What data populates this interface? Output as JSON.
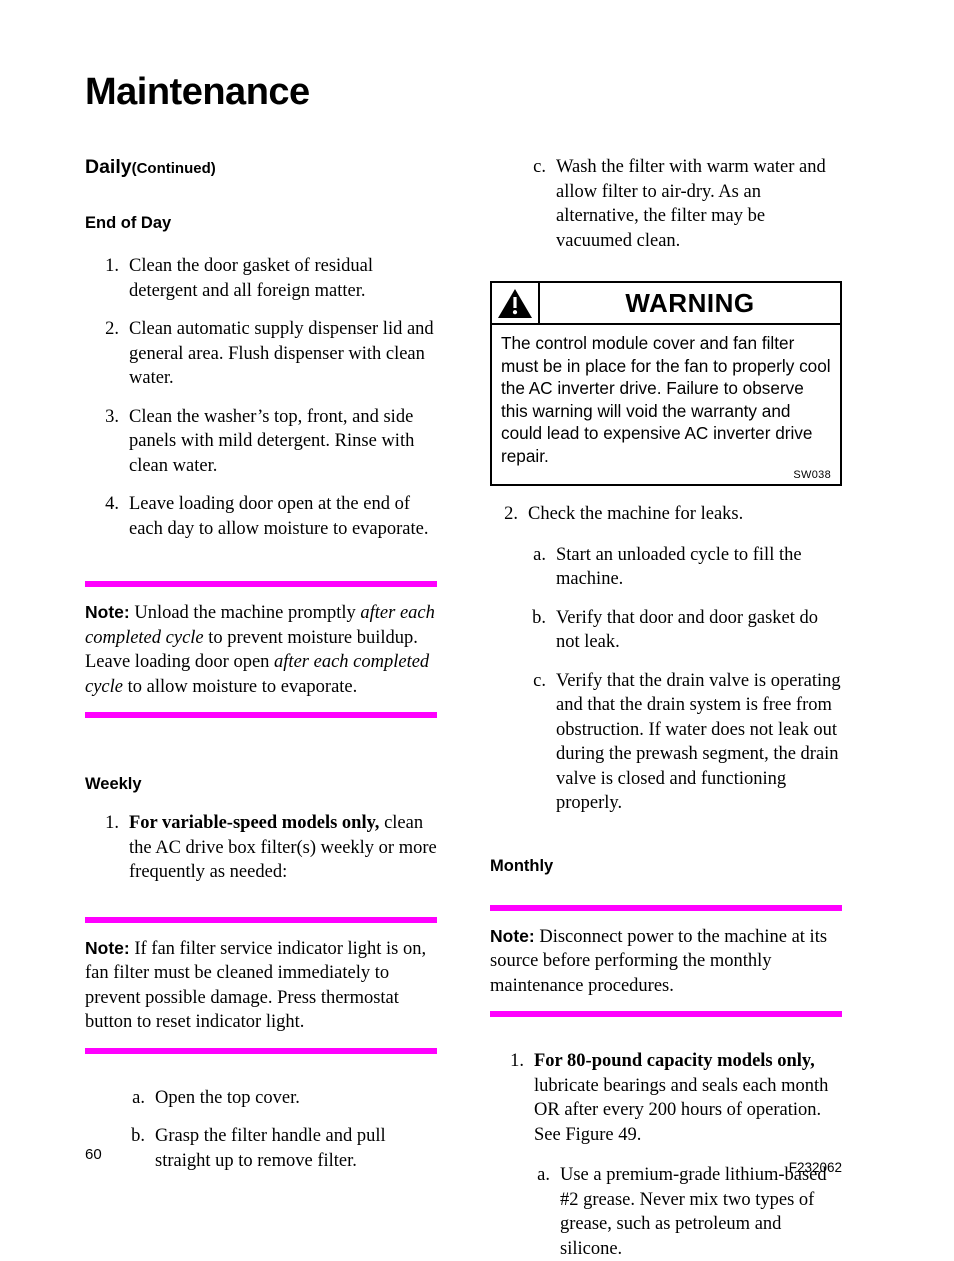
{
  "document": {
    "title": "Maintenance",
    "page_number": "60",
    "document_code": "F232062"
  },
  "left_column": {
    "section_heading": "Daily",
    "section_heading_continued": "(Continued)",
    "subsection_heading": "End of Day",
    "end_of_day_items": [
      {
        "marker": "1.",
        "text": "Clean the door gasket of residual detergent and all foreign matter."
      },
      {
        "marker": "2.",
        "text": "Clean automatic supply dispenser lid and general area. Flush dispenser with clean water."
      },
      {
        "marker": "3.",
        "text": "Clean the washer’s top, front, and side panels with mild detergent. Rinse with clean water."
      },
      {
        "marker": "4.",
        "text": "Leave loading door open at the end of each day to allow moisture to evaporate."
      }
    ],
    "note_1": {
      "label": "Note:",
      "segments": [
        {
          "text": " Unload the machine promptly ",
          "style": "normal"
        },
        {
          "text": "after each completed cycle",
          "style": "italic"
        },
        {
          "text": " to prevent moisture buildup. Leave loading door open ",
          "style": "normal"
        },
        {
          "text": "after each completed cycle",
          "style": "italic"
        },
        {
          "text": " to allow moisture to evaporate.",
          "style": "normal"
        }
      ]
    },
    "weekly_heading": "Weekly",
    "weekly_items": [
      {
        "marker": "1.",
        "bold_lead": "For variable-speed models only,",
        "text": " clean the AC drive box filter(s) weekly or more frequently as needed:"
      }
    ],
    "note_2": {
      "label": "Note:",
      "text": " If fan filter service indicator light is on, fan filter must be cleaned immediately to prevent possible damage. Press thermostat button to reset indicator light."
    },
    "weekly_sub_items": [
      {
        "marker": "a.",
        "text": "Open the top cover."
      },
      {
        "marker": "b.",
        "text": "Grasp the filter handle and pull straight up to remove filter."
      }
    ]
  },
  "right_column": {
    "continued_sub_items": [
      {
        "marker": "c.",
        "text": "Wash the filter with warm water and allow filter to air-dry. As an alternative, the filter may be vacuumed clean."
      }
    ],
    "warning": {
      "icon_name": "warning-triangle-icon",
      "title": "WARNING",
      "body": "The control module cover and fan filter must be in place for the fan to properly cool the AC inverter drive. Failure to observe this warning will void the warranty and could lead to expensive AC inverter drive repair.",
      "code": "SW038"
    },
    "leak_check_items": [
      {
        "marker": "2.",
        "text": "Check the machine for leaks."
      }
    ],
    "leak_check_sub_items": [
      {
        "marker": "a.",
        "text": "Start an unloaded cycle to fill the machine."
      },
      {
        "marker": "b.",
        "text": "Verify that door and door gasket do not leak."
      },
      {
        "marker": "c.",
        "text": "Verify that the drain valve is operating and that the drain system is free from obstruction. If water does not leak out during the prewash segment, the drain valve is closed and functioning properly."
      }
    ],
    "monthly_heading": "Monthly",
    "note_3": {
      "label": "Note:",
      "text": " Disconnect power to the machine at its source before performing the monthly maintenance procedures."
    },
    "monthly_items": [
      {
        "marker": "1.",
        "bold_lead": "For 80-pound capacity models only,",
        "text": " lubricate bearings and seals each month OR after every 200 hours of operation. See Figure 49."
      }
    ],
    "monthly_sub_items": [
      {
        "marker": "a.",
        "text": "Use a premium-grade lithium-based #2 grease. Never mix two types of grease, such as petroleum and silicone."
      }
    ]
  },
  "colors": {
    "note_rule": "#ff00ff",
    "text": "#000000",
    "background": "#ffffff"
  }
}
